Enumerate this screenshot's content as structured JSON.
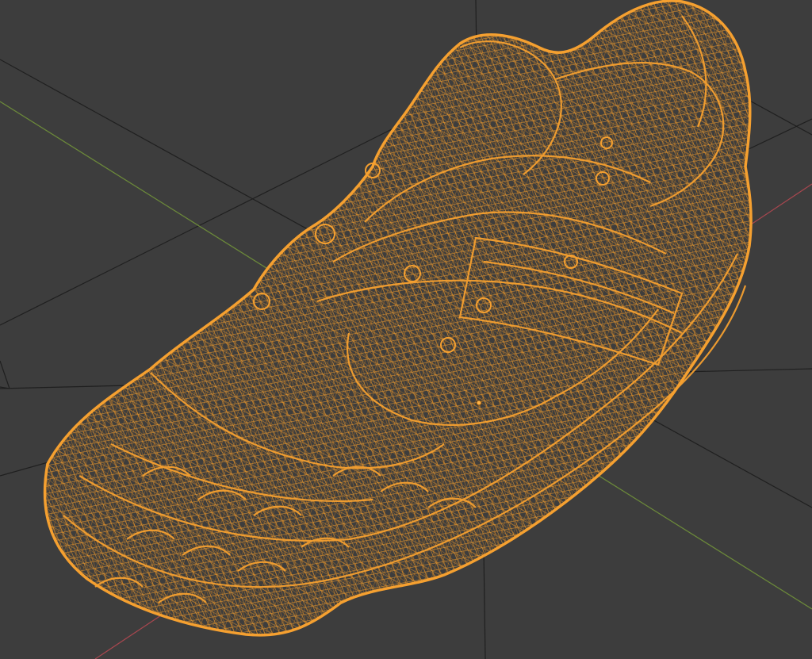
{
  "viewport": {
    "view_mode": "wireframe",
    "object": "shoe-mesh",
    "object_selected": true,
    "show_grid_floor": true,
    "show_x_axis": true,
    "show_y_axis": true
  },
  "colors": {
    "background": "#3d3d3d",
    "grid_line": "#1f1f1f",
    "x_axis": "#a8474f",
    "y_axis": "#6c8a3a",
    "wireframe_selected": "#f5a030",
    "wireframe_dense": "#e08a1e"
  }
}
